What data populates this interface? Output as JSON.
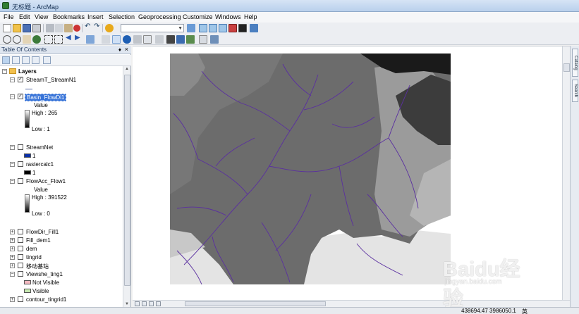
{
  "window": {
    "title": "无标题 - ArcMap"
  },
  "menus": [
    "File",
    "Edit",
    "View",
    "Bookmarks",
    "Insert",
    "Selection",
    "Geoprocessing",
    "Customize",
    "Windows",
    "Help"
  ],
  "toc": {
    "title": "Table Of Contents",
    "pin_glyph": "♦",
    "close_glyph": "×",
    "root": "Layers",
    "layers": [
      {
        "name": "StreamT_StreamN1",
        "checked": true,
        "expanded": true
      },
      {
        "name": "Basin_FlowDi1",
        "checked": true,
        "expanded": true,
        "selected": true,
        "field": "Value",
        "high": "High : 265",
        "low": "Low : 1"
      },
      {
        "name": "StreamNet",
        "checked": false,
        "expanded": true,
        "class_value": "1"
      },
      {
        "name": "rastercalc1",
        "checked": false,
        "expanded": true,
        "class_value": "1"
      },
      {
        "name": "FlowAcc_Flow1",
        "checked": false,
        "expanded": true,
        "field": "Value",
        "high": "High : 391522",
        "low": "Low : 0"
      },
      {
        "name": "FlowDir_Fill1",
        "checked": false,
        "expanded": false
      },
      {
        "name": "Fill_dem1",
        "checked": false,
        "expanded": false
      },
      {
        "name": "dem",
        "checked": false,
        "expanded": false
      },
      {
        "name": "tingrid",
        "checked": false,
        "expanded": false
      },
      {
        "name": "移动基站",
        "checked": false,
        "expanded": false
      },
      {
        "name": "Viewshe_ting1",
        "checked": false,
        "expanded": true,
        "classes": [
          "Not Visible",
          "Visible"
        ]
      },
      {
        "name": "contour_tingrid1",
        "checked": false,
        "expanded": false
      }
    ]
  },
  "side_tabs": [
    "Catalog",
    "Search"
  ],
  "status": {
    "coords": "438694.47  3986050.1",
    "ime": "英"
  },
  "colors": {
    "streamnet": "#0a2fa8",
    "not_visible": "#f3b9c0",
    "visible": "#c6e8b0",
    "stream_lines": "#5a2fa0"
  },
  "watermark": {
    "brand": "Baidu经验",
    "url": "jingyan.baidu.com"
  }
}
